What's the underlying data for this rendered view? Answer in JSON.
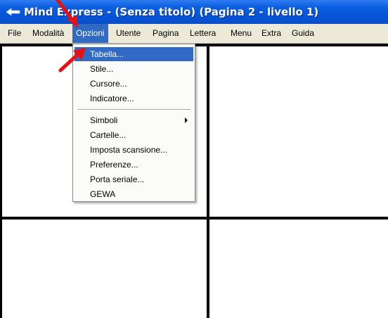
{
  "window": {
    "title": "Mind Express - (Senza titolo) (Pagina 2 - livello 1)",
    "title_icon": "mind-express-app-icon"
  },
  "menubar": {
    "items": [
      {
        "label": "File"
      },
      {
        "label": "Modalità"
      },
      {
        "label": "Opzioni",
        "active": true
      },
      {
        "label": "Utente"
      },
      {
        "label": "Pagina"
      },
      {
        "label": "Lettera"
      },
      {
        "label": "Menu"
      },
      {
        "label": "Extra"
      },
      {
        "label": "Guida"
      }
    ]
  },
  "options_menu": {
    "items": [
      {
        "label": "Tabella...",
        "selected": true
      },
      {
        "label": "Stile..."
      },
      {
        "label": "Cursore..."
      },
      {
        "label": "Indicatore..."
      },
      {
        "label": "Simboli",
        "has_submenu": true
      },
      {
        "label": "Cartelle..."
      },
      {
        "label": "Imposta scansione..."
      },
      {
        "label": "Preferenze..."
      },
      {
        "label": "Porta seriale..."
      },
      {
        "label": "GEWA"
      }
    ]
  },
  "annotations": {
    "arrow_color": "#e81010",
    "arrows": [
      "red-arrow-pointing-opzioni",
      "red-arrow-pointing-tabella"
    ]
  },
  "colors": {
    "titlebar": "#0653d6",
    "highlight": "#316ac5",
    "menubar": "#ece9d8"
  }
}
